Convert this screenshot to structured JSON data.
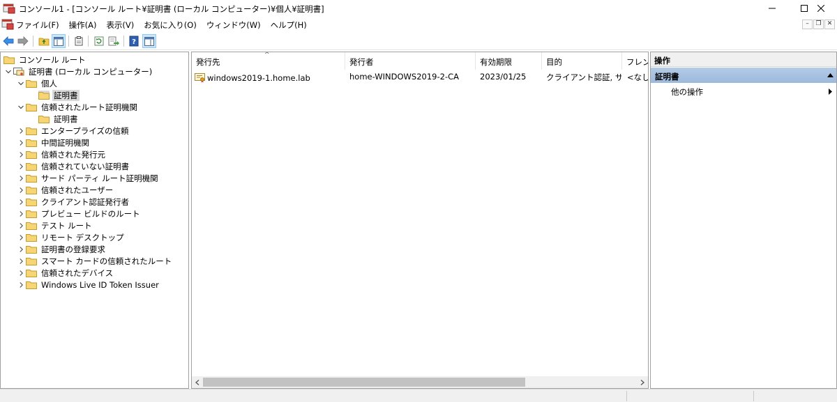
{
  "window": {
    "title": "コンソール1 - [コンソール ルート¥証明書 (ローカル コンピューター)¥個人¥証明書]",
    "minimize_glyph": "—",
    "maximize_glyph": "☐",
    "close_glyph": "✕"
  },
  "menu": {
    "items": [
      "ファイル(F)",
      "操作(A)",
      "表示(V)",
      "お気に入り(O)",
      "ウィンドウ(W)",
      "ヘルプ(H)"
    ],
    "mdi_minimize": "–",
    "mdi_restore": "❐",
    "mdi_close": "✕"
  },
  "tree": {
    "root": "コンソール ルート",
    "cert_store": "証明書 (ローカル コンピューター)",
    "personal": "個人",
    "personal_certs": "証明書",
    "trusted_root": "信頼されたルート証明機関",
    "trusted_root_certs": "証明書",
    "others": [
      "エンタープライズの信頼",
      "中間証明機関",
      "信頼された発行元",
      "信頼されていない証明書",
      "サード パーティ ルート証明機関",
      "信頼されたユーザー",
      "クライアント認証発行者",
      "プレビュー ビルドのルート",
      "テスト ルート",
      "リモート デスクトップ",
      "証明書の登録要求",
      "スマート カードの信頼されたルート",
      "信頼されたデバイス",
      "Windows Live ID Token Issuer"
    ]
  },
  "list": {
    "columns": [
      "発行先",
      "発行者",
      "有効期限",
      "目的",
      "フレンドリ名"
    ],
    "sort_indicator": "^",
    "rows": [
      {
        "issued_to": "windows2019-1.home.lab",
        "issued_by": "home-WINDOWS2019-2-CA",
        "expires": "2023/01/25",
        "purposes": "クライアント認証, サー...",
        "friendly_name": "<なし>"
      }
    ]
  },
  "actions": {
    "header": "操作",
    "section": "証明書",
    "more": "他の操作"
  },
  "colors": {
    "selection": "#d9d9d9",
    "action_section": "#a9c2e1",
    "pane_border": "#a0a0a0"
  }
}
